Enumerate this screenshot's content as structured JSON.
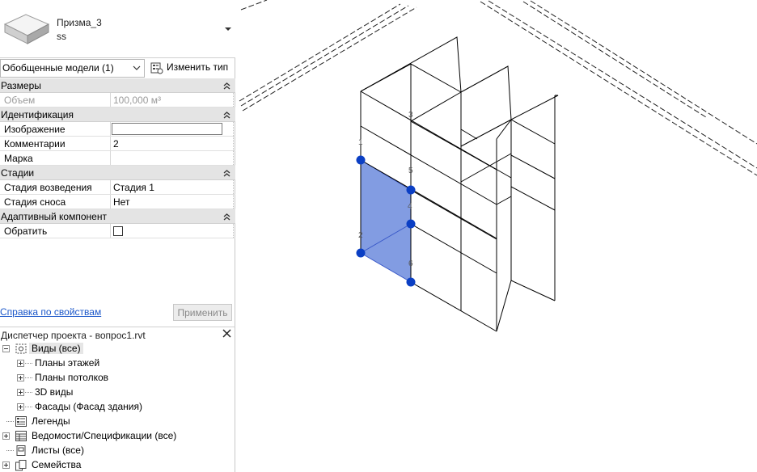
{
  "type_selector": {
    "family_name": "Призма_3",
    "type_name": "ss"
  },
  "filter": {
    "selected": "Обобщенные модели (1)",
    "edit_type_label": "Изменить тип"
  },
  "groups": {
    "dimensions": "Размеры",
    "identity": "Идентификация",
    "phasing": "Стадии",
    "adaptive": "Адаптивный компонент"
  },
  "props": {
    "volume": {
      "name": "Объем",
      "value": "100,000 м³"
    },
    "image": {
      "name": "Изображение"
    },
    "comments": {
      "name": "Комментарии",
      "value": "2"
    },
    "mark": {
      "name": "Марка",
      "value": ""
    },
    "phase_created": {
      "name": "Стадия возведения",
      "value": "Стадия 1"
    },
    "phase_demolished": {
      "name": "Стадия сноса",
      "value": "Нет"
    },
    "flip": {
      "name": "Обратить"
    }
  },
  "properties_help": "Справка по свойствам",
  "apply_label": "Применить",
  "project_browser": {
    "title": "Диспетчер проекта - вопрос1.rvt",
    "nodes": {
      "views": "Виды (все)",
      "floor_plans": "Планы этажей",
      "ceiling_plans": "Планы потолков",
      "views_3d": "3D виды",
      "elevations": "Фасады (Фасад здания)",
      "legends": "Легенды",
      "schedules": "Ведомости/Спецификации (все)",
      "sheets": "Листы (все)",
      "families": "Семейства"
    }
  },
  "point_labels": [
    "1",
    "2",
    "3",
    "4",
    "5",
    "6"
  ],
  "colors": {
    "selection_fill": "#7b97e0",
    "grip": "#0b3fc4",
    "link": "#1a56c9"
  }
}
